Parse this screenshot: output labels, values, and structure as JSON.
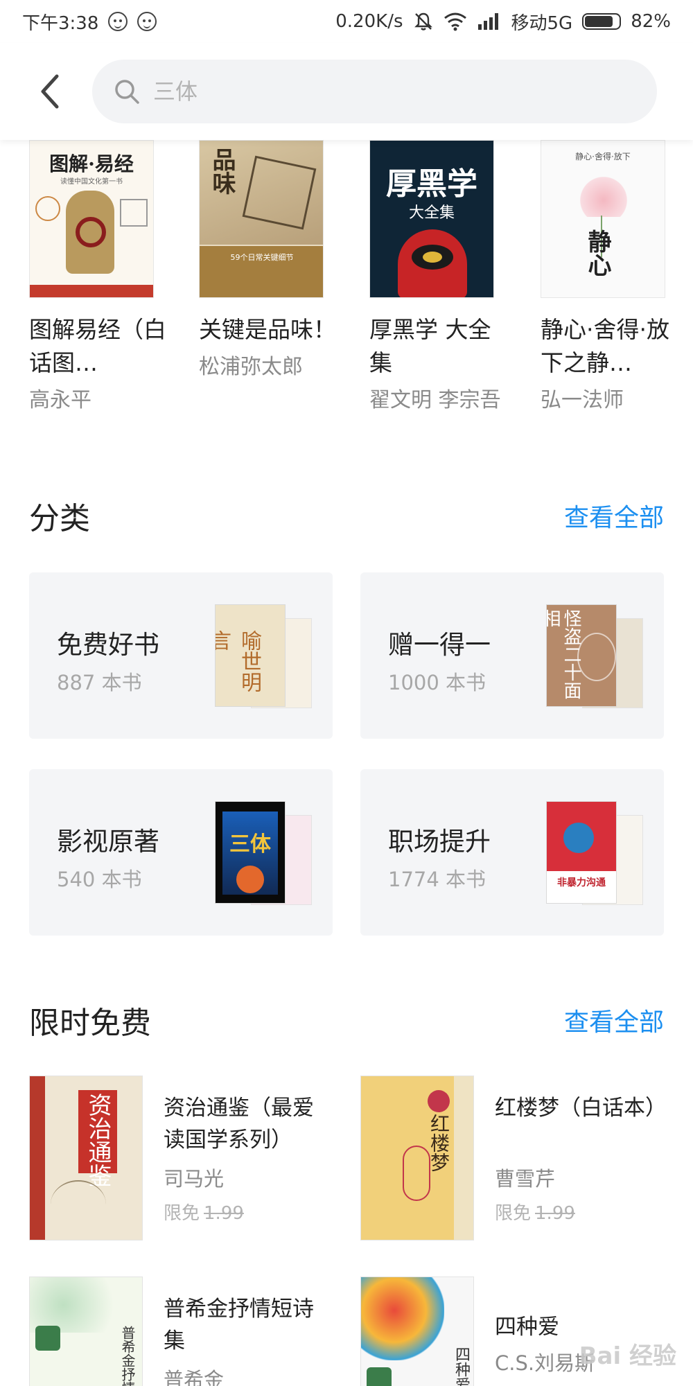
{
  "status_bar": {
    "time": "下午3:38",
    "net_speed": "0.20K/s",
    "carrier": "移动5G",
    "battery": "82%",
    "battery_level": 0.82
  },
  "search": {
    "placeholder": "三体"
  },
  "top_books": [
    {
      "title": "图解易经（白话图…",
      "author": "高永平",
      "cover_title": "图解·易经",
      "cover_subtitle": "读懂中国文化第一书"
    },
    {
      "title": "关键是品味！",
      "author": "松浦弥太郎",
      "cover_title": "品味",
      "cover_subtitle": "59个日常关键细节"
    },
    {
      "title": "厚黑学 大全集",
      "author": "翟文明 李宗吾",
      "cover_title": "厚黑学",
      "cover_subtitle": "大全集"
    },
    {
      "title": "静心·舍得·放下之静…",
      "author": "弘一法师",
      "cover_title": "静心",
      "cover_subtitle": "静心·舍得·放下"
    }
  ],
  "categories": {
    "title": "分类",
    "view_all": "查看全部",
    "items": [
      {
        "name": "免费好书",
        "count": "887 本书",
        "cover_text": "喻世明言"
      },
      {
        "name": "赠一得一",
        "count": "1000 本书",
        "cover_text": "怪盗二十面相"
      },
      {
        "name": "影视原著",
        "count": "540 本书",
        "cover_text": "三体"
      },
      {
        "name": "职场提升",
        "count": "1774 本书",
        "cover_text": "非暴力沟通"
      }
    ]
  },
  "free": {
    "title": "限时免费",
    "view_all": "查看全部",
    "items": [
      {
        "title": "资治通鉴（最爱读国学系列）",
        "author": "司马光",
        "price_label": "限免",
        "old_price": "1.99",
        "cover_text": "资治通鉴"
      },
      {
        "title": "红楼梦（白话本）",
        "author": "曹雪芹",
        "price_label": "限免",
        "old_price": "1.99",
        "cover_text": "红楼梦"
      },
      {
        "title": "普希金抒情短诗集",
        "author": "普希金",
        "cover_text": "普希金抒情短诗"
      },
      {
        "title": "四种爱",
        "author": "C.S.刘易斯",
        "cover_text": "四种爱"
      }
    ]
  },
  "watermark": "Bai 经验"
}
